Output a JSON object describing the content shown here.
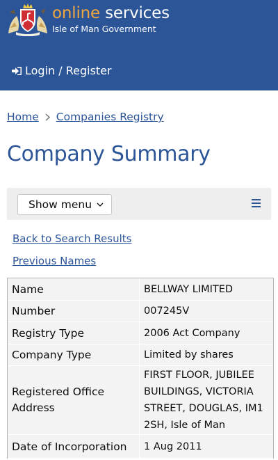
{
  "header": {
    "brand_part1": "online",
    "brand_part2": "services",
    "subtitle": "Isle of Man Government",
    "login_label": "Login / Register"
  },
  "breadcrumb": {
    "home": "Home",
    "current": "Companies Registry"
  },
  "page_title": "Company Summary",
  "menu": {
    "show_menu_label": "Show menu"
  },
  "links": {
    "back": "Back to Search Results",
    "previous_names": "Previous Names"
  },
  "summary": {
    "rows": [
      {
        "label": "Name",
        "value": "BELLWAY LIMITED"
      },
      {
        "label": "Number",
        "value": "007245V"
      },
      {
        "label": "Registry Type",
        "value": "2006 Act Company"
      },
      {
        "label": "Company Type",
        "value": "Limited by shares"
      },
      {
        "label": "Registered Office Address",
        "value": "FIRST FLOOR, JUBILEE BUILDINGS, VICTORIA STREET, DOUGLAS, IM1 2SH, Isle of Man"
      },
      {
        "label": "Date of Incorporation",
        "value": "1 Aug 2011"
      }
    ]
  },
  "colors": {
    "brand_blue": "#2c5597",
    "brand_accent": "#f0a640",
    "table_bg": "#f3f3f3",
    "menubar_bg": "#eeeeee"
  },
  "icons": {
    "logo": "isle-of-man-crest",
    "login": "sign-in-icon",
    "breadcrumb_separator": "chevron-right-icon",
    "show_menu": "chevron-down-icon",
    "menu": "hamburger-icon"
  }
}
